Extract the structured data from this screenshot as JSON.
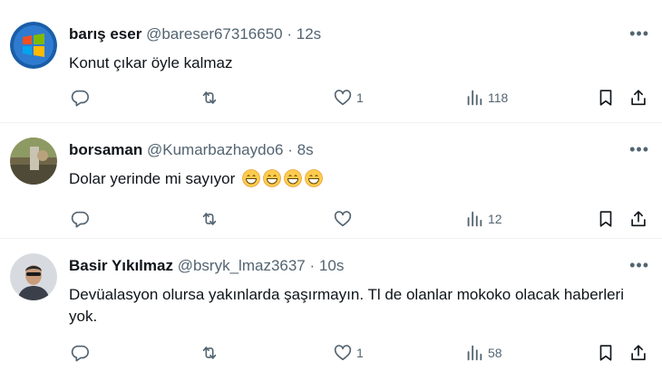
{
  "tweets": [
    {
      "display_name": "barış eser",
      "handle": "@bareser67316650",
      "separator": "·",
      "time": "12s",
      "text": "Konut çıkar öyle kalmaz",
      "emoji_count": 0,
      "likes": "1",
      "views": "118",
      "avatar": "windows-logo"
    },
    {
      "display_name": "borsaman",
      "handle": "@Kumarbazhaydo6",
      "separator": "·",
      "time": "8s",
      "text": "Dolar yerinde mi sayıyor",
      "emoji_count": 4,
      "emoji": "grinning-face",
      "likes": "",
      "views": "12",
      "avatar": "photo"
    },
    {
      "display_name": "Basir Yıkılmaz",
      "handle": "@bsryk_lmaz3637",
      "separator": "·",
      "time": "10s",
      "text": "Devüalasyon olursa yakınlarda şaşırmayın. Tl de olanlar mokoko olacak haberleri yok.",
      "emoji_count": 0,
      "likes": "1",
      "views": "58",
      "avatar": "photo"
    }
  ],
  "icons": {
    "more": "more-icon",
    "reply": "reply-icon",
    "retweet": "retweet-icon",
    "like": "heart-icon",
    "views": "views-icon",
    "bookmark": "bookmark-icon",
    "share": "share-icon"
  },
  "colors": {
    "text": "#0f1419",
    "secondary": "#536471",
    "divider": "#eff3f4"
  }
}
